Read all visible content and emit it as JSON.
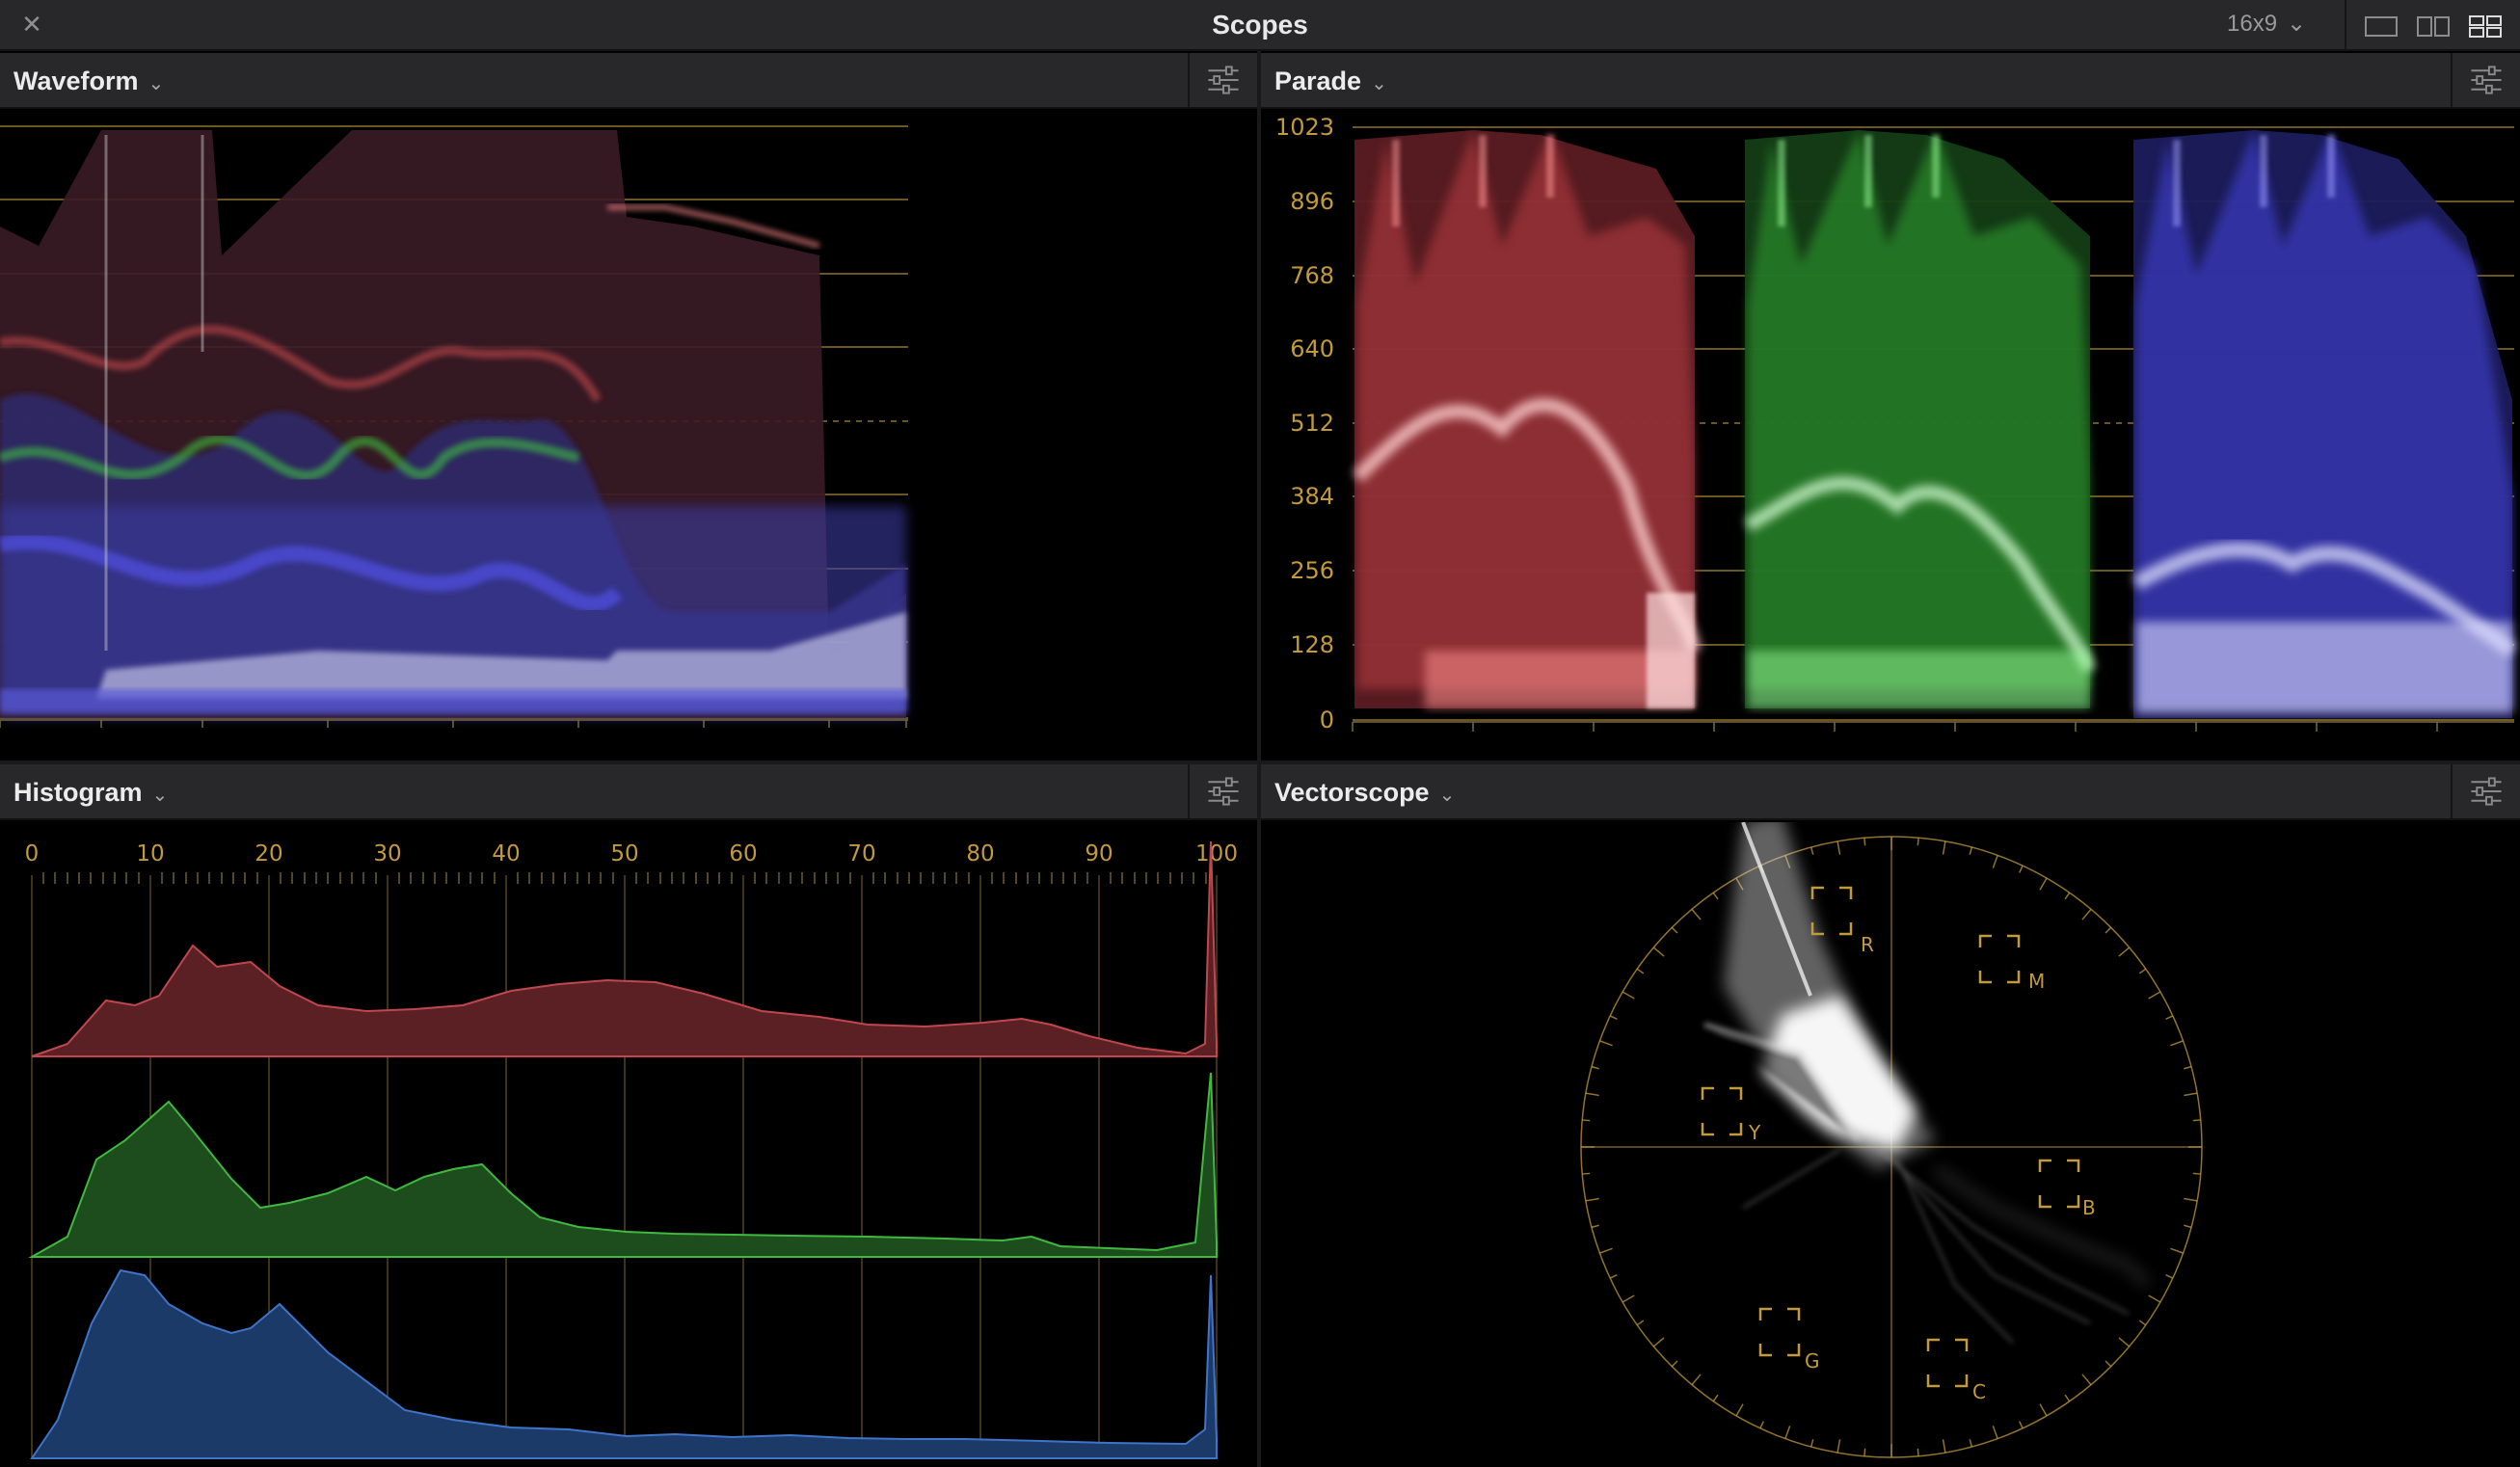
{
  "window": {
    "close_glyph": "✕",
    "title": "Scopes",
    "aspect_ratio": "16x9",
    "aspect_chevron": "⌄",
    "layout_buttons": [
      "layout-single-icon",
      "layout-dual-icon",
      "layout-quad-icon"
    ]
  },
  "panels": {
    "waveform": {
      "title": "Waveform",
      "chevron": "⌄",
      "settings_icon": "sliders-icon"
    },
    "parade": {
      "title": "Parade",
      "chevron": "⌄",
      "settings_icon": "sliders-icon",
      "scale_labels": [
        "1023",
        "896",
        "768",
        "640",
        "512",
        "384",
        "256",
        "128",
        "0"
      ]
    },
    "histogram": {
      "title": "Histogram",
      "chevron": "⌄",
      "settings_icon": "sliders-icon",
      "scale_labels": [
        "0",
        "10",
        "20",
        "30",
        "40",
        "50",
        "60",
        "70",
        "80",
        "90",
        "100"
      ]
    },
    "vectorscope": {
      "title": "Vectorscope",
      "chevron": "⌄",
      "settings_icon": "sliders-icon",
      "targets": [
        "R",
        "M",
        "Y",
        "B",
        "G",
        "C"
      ]
    }
  },
  "colors": {
    "graticule": "#c29a3c",
    "red": "#e05252",
    "green": "#3fcf3f",
    "blue": "#4b4bff"
  }
}
